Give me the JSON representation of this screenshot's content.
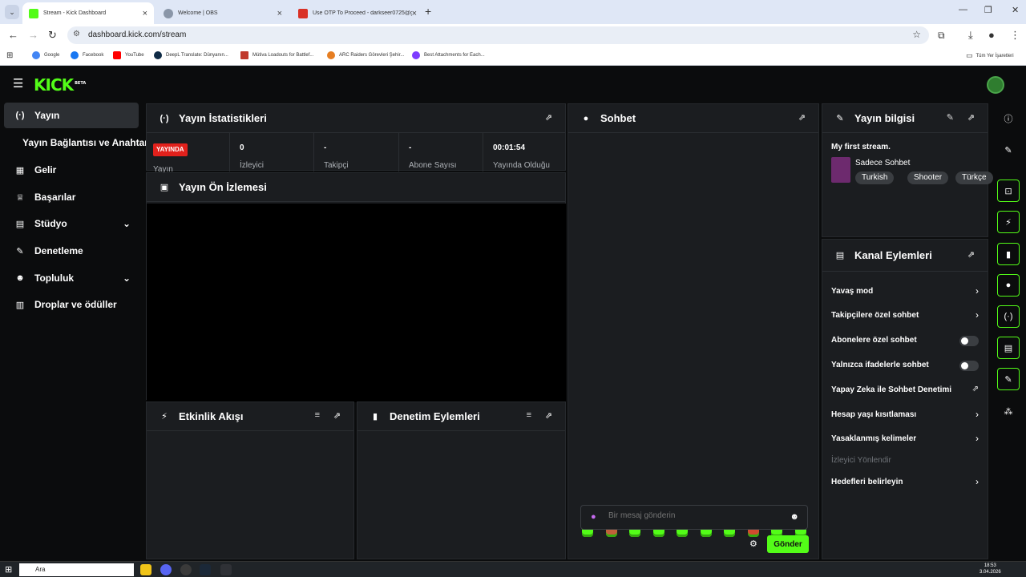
{
  "browser": {
    "tabs": [
      {
        "title": "Stream - Kick Dashboard",
        "color": "#53fc18"
      },
      {
        "title": "Welcome | OBS",
        "color": "#8a96a8"
      },
      {
        "title": "Use OTP To Proceed - darkseer0725@gm...",
        "color": "#d93025"
      }
    ],
    "url": "dashboard.kick.com/stream",
    "bookmarks": [
      {
        "label": "Google",
        "color": "#4285f4"
      },
      {
        "label": "Facebook",
        "color": "#1877f2"
      },
      {
        "label": "YouTube",
        "color": "#ff0000"
      },
      {
        "label": "DeepL Translate: Dünyanın...",
        "color": "#0f2b46"
      },
      {
        "label": "Mútiva Loadouts for Battlef...",
        "color": "#c0392b"
      },
      {
        "label": "ARC Raiders Görevleri Şehir...",
        "color": "#e67e22"
      },
      {
        "label": "Best Attachments for Each...",
        "color": "#7d3cff"
      }
    ],
    "all_bookmarks": "Tüm Yer İşaretleri"
  },
  "app": {
    "logo": "KICK",
    "logo_badge": "BETA"
  },
  "sidebar": {
    "items": [
      {
        "label": "Yayın",
        "icon": "broadcast-icon",
        "glyph": "(·)"
      },
      {
        "label": "Yayın Bağlantısı ve Anahtarı",
        "icon": "",
        "glyph": ""
      },
      {
        "label": "Gelir",
        "icon": "chart-icon",
        "glyph": "▦"
      },
      {
        "label": "Başarılar",
        "icon": "trophy-icon",
        "glyph": "♕"
      },
      {
        "label": "Stüdyo",
        "icon": "studio-icon",
        "glyph": "▤"
      },
      {
        "label": "Denetleme",
        "icon": "wrench-icon",
        "glyph": "✎"
      },
      {
        "label": "Topluluk",
        "icon": "community-icon",
        "glyph": "👥"
      },
      {
        "label": "Droplar ve ödüller",
        "icon": "gift-icon",
        "glyph": "▥"
      }
    ]
  },
  "stats": {
    "title": "Yayın İstatistikleri",
    "live_badge": "YAYINDA",
    "live_label": "Yayın",
    "items": [
      {
        "value": "0",
        "label": "İzleyici"
      },
      {
        "value": "-",
        "label": "Takipçi"
      },
      {
        "value": "-",
        "label": "Abone Sayısı"
      },
      {
        "value": "00:01:54",
        "label": "Yayında Olduğu"
      }
    ]
  },
  "preview": {
    "title": "Yayın Ön İzlemesi"
  },
  "activity": {
    "title": "Etkinlik Akışı"
  },
  "moderation": {
    "title": "Denetim Eylemleri"
  },
  "chat": {
    "title": "Sohbet",
    "placeholder": "Bir mesaj gönderin",
    "send": "Gönder"
  },
  "stream_info": {
    "title": "Yayın bilgisi",
    "stream_title": "My first stream.",
    "category": "Sadece Sohbet",
    "tags": [
      "Turkish",
      "Shooter",
      "Türkçe"
    ]
  },
  "channel_actions": {
    "title": "Kanal Eylemleri",
    "items": [
      {
        "label": "Yavaş mod",
        "control": "chevron"
      },
      {
        "label": "Takipçilere özel sohbet",
        "control": "chevron"
      },
      {
        "label": "Abonelere özel sohbet",
        "control": "toggle"
      },
      {
        "label": "Yalnızca ifadelerle sohbet",
        "control": "toggle"
      },
      {
        "label": "Yapay Zeka ile Sohbet Denetimi",
        "control": "external"
      },
      {
        "label": "Hesap yaşı kısıtlaması",
        "control": "chevron"
      },
      {
        "label": "Yasaklanmış kelimeler",
        "control": "chevron"
      },
      {
        "label": "İzleyici Yönlendir",
        "control": "none"
      },
      {
        "label": "Hedefleri belirleyin",
        "control": "chevron"
      }
    ]
  },
  "taskbar": {
    "search": "Ara",
    "time": "18:53",
    "date": "3.04.2026"
  },
  "accent_color": "#53fc18"
}
